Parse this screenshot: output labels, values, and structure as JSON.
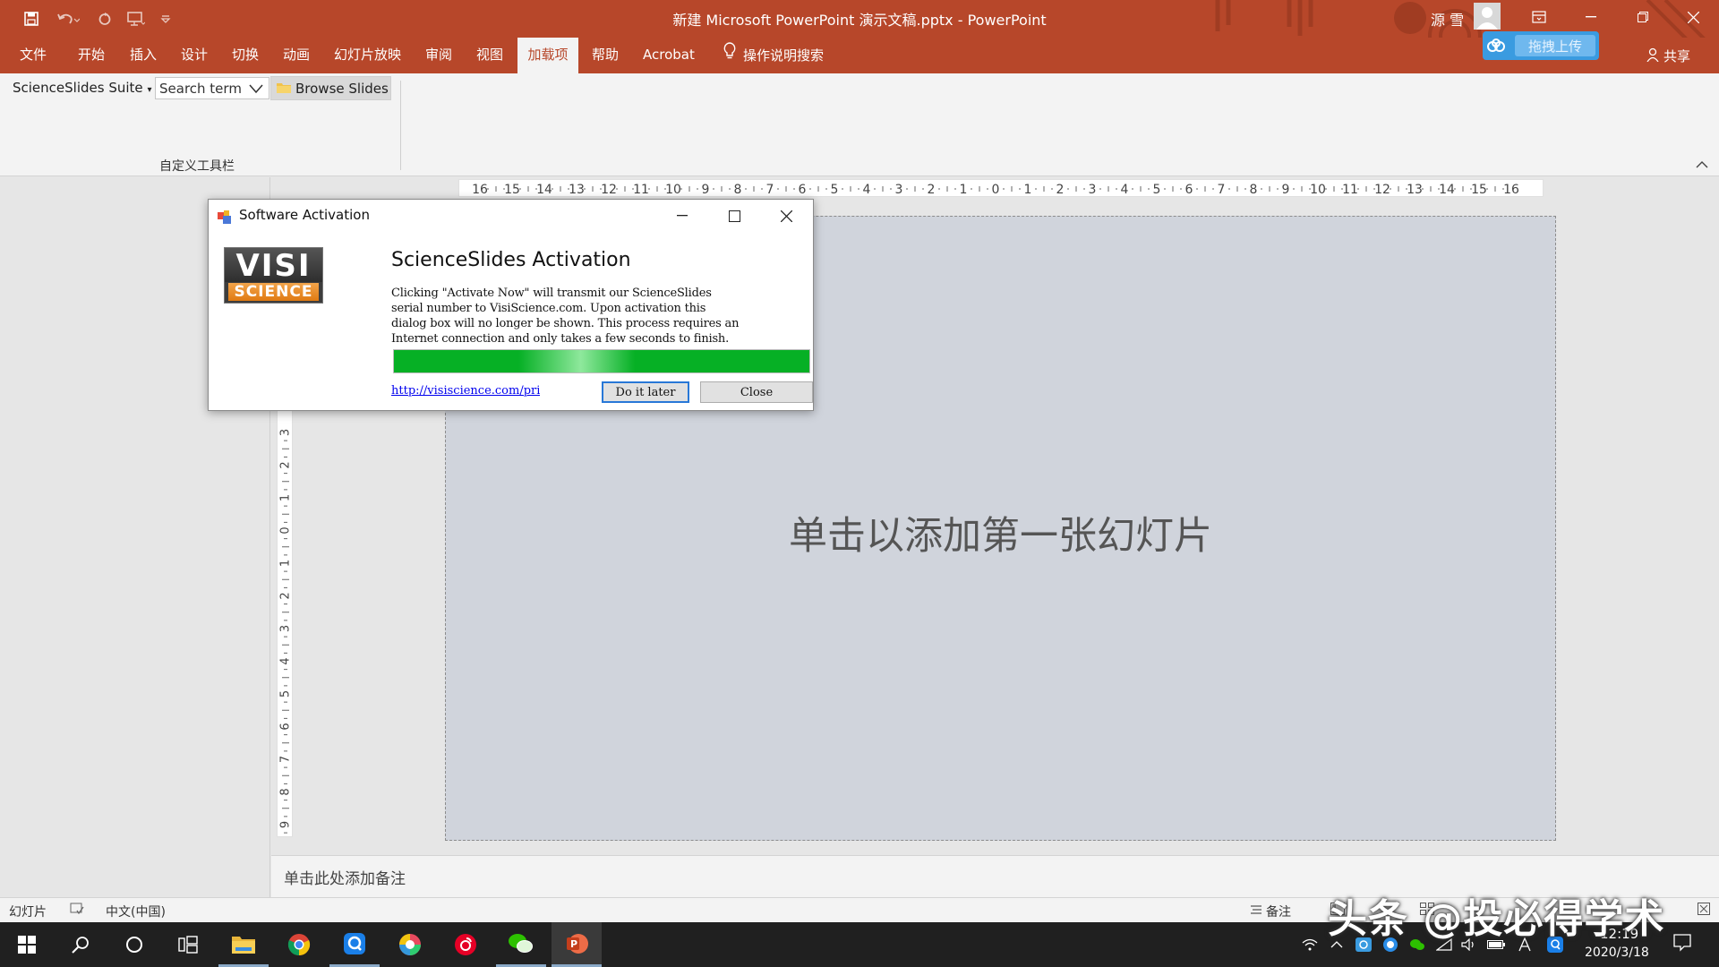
{
  "titlebar": {
    "document_title": "新建 Microsoft PowerPoint 演示文稿.pptx  -  PowerPoint",
    "user_name": "源 雪",
    "upload_label": "拖拽上传",
    "share_label": "共享",
    "accent_color": "#b7472a"
  },
  "tabs": [
    {
      "label": "文件"
    },
    {
      "label": "开始"
    },
    {
      "label": "插入"
    },
    {
      "label": "设计"
    },
    {
      "label": "切换"
    },
    {
      "label": "动画"
    },
    {
      "label": "幻灯片放映"
    },
    {
      "label": "审阅"
    },
    {
      "label": "视图"
    },
    {
      "label": "加载项",
      "active": true
    },
    {
      "label": "帮助"
    },
    {
      "label": "Acrobat"
    },
    {
      "label": "操作说明搜索",
      "icon": "lightbulb-icon"
    }
  ],
  "ribbon": {
    "suite_label": "ScienceSlides Suite",
    "search_value": "Search term",
    "browse_label": "Browse Slides",
    "group_label": "自定义工具栏"
  },
  "rulers": {
    "horizontal_ticks": [
      "16",
      "15",
      "14",
      "13",
      "12",
      "11",
      "10",
      "9",
      "8",
      "7",
      "6",
      "5",
      "4",
      "3",
      "2",
      "1",
      "0",
      "1",
      "2",
      "3",
      "4",
      "5",
      "6",
      "7",
      "8",
      "9",
      "10",
      "11",
      "12",
      "13",
      "14",
      "15",
      "16"
    ],
    "vertical_ticks": [
      "3",
      "2",
      "1",
      "0",
      "1",
      "2",
      "3",
      "4",
      "5",
      "6",
      "7",
      "8",
      "9"
    ]
  },
  "slide": {
    "placeholder": "单击以添加第一张幻灯片"
  },
  "notes": {
    "placeholder": "单击此处添加备注"
  },
  "statusbar": {
    "slides_label": "幻灯片",
    "language": "中文(中国)",
    "notes_label": "备注"
  },
  "watermark": "头条 @投必得学术",
  "taskbar": {
    "clock_time": "12:19",
    "clock_date": "2020/3/18"
  },
  "dialog": {
    "title": "Software Activation",
    "logo_top": "VISI",
    "logo_bottom": "SCIENCE",
    "heading": "ScienceSlides Activation",
    "body": "Clicking \"Activate Now\" will transmit our ScienceSlides\nserial number to VisiScience.com. Upon activation this\ndialog box will no longer be shown. This process requires an\nInternet connection and only takes a few seconds to finish.",
    "progress": 1.0,
    "progress_color": "#06b025",
    "link": "http://visiscience.com/privacy",
    "later_label": "Do it later",
    "close_label": "Close"
  }
}
